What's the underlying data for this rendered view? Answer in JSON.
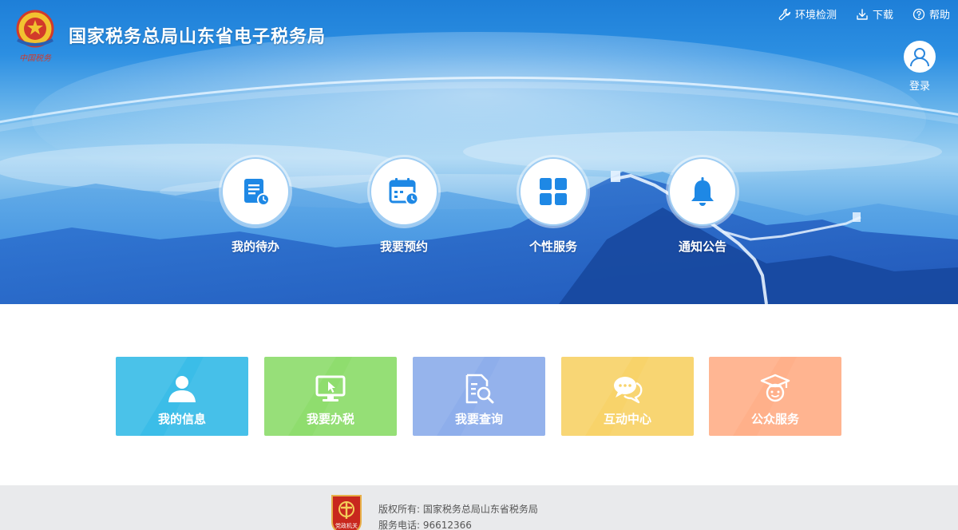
{
  "header": {
    "title": "国家税务总局山东省电子税务局",
    "logo_text": "中国税务",
    "links": [
      {
        "label": "环境检测",
        "icon": "wrench-icon"
      },
      {
        "label": "下载",
        "icon": "download-icon"
      },
      {
        "label": "帮助",
        "icon": "help-icon"
      }
    ],
    "login_label": "登录"
  },
  "hero_nav": [
    {
      "label": "我的待办",
      "icon": "todo-list-icon"
    },
    {
      "label": "我要预约",
      "icon": "calendar-clock-icon"
    },
    {
      "label": "个性服务",
      "icon": "grid-icon"
    },
    {
      "label": "通知公告",
      "icon": "bell-icon"
    }
  ],
  "cards": [
    {
      "label": "我的信息",
      "icon": "user-icon",
      "color": "#3bbde8"
    },
    {
      "label": "我要办税",
      "icon": "monitor-cursor-icon",
      "color": "#8fdd6e"
    },
    {
      "label": "我要查询",
      "icon": "document-search-icon",
      "color": "#8eaeeb"
    },
    {
      "label": "互动中心",
      "icon": "chat-bubbles-icon",
      "color": "#f8d36a"
    },
    {
      "label": "公众服务",
      "icon": "graduate-icon",
      "color": "#ffb08a"
    }
  ],
  "footer": {
    "badge_text": "党政机关",
    "copyright": "版权所有: 国家税务总局山东省税务局",
    "phone": "服务电话: 96612366"
  },
  "colors": {
    "primary": "#2a86dd",
    "icon_blue": "#1e88e5",
    "footer_bg": "#e9eaec"
  }
}
